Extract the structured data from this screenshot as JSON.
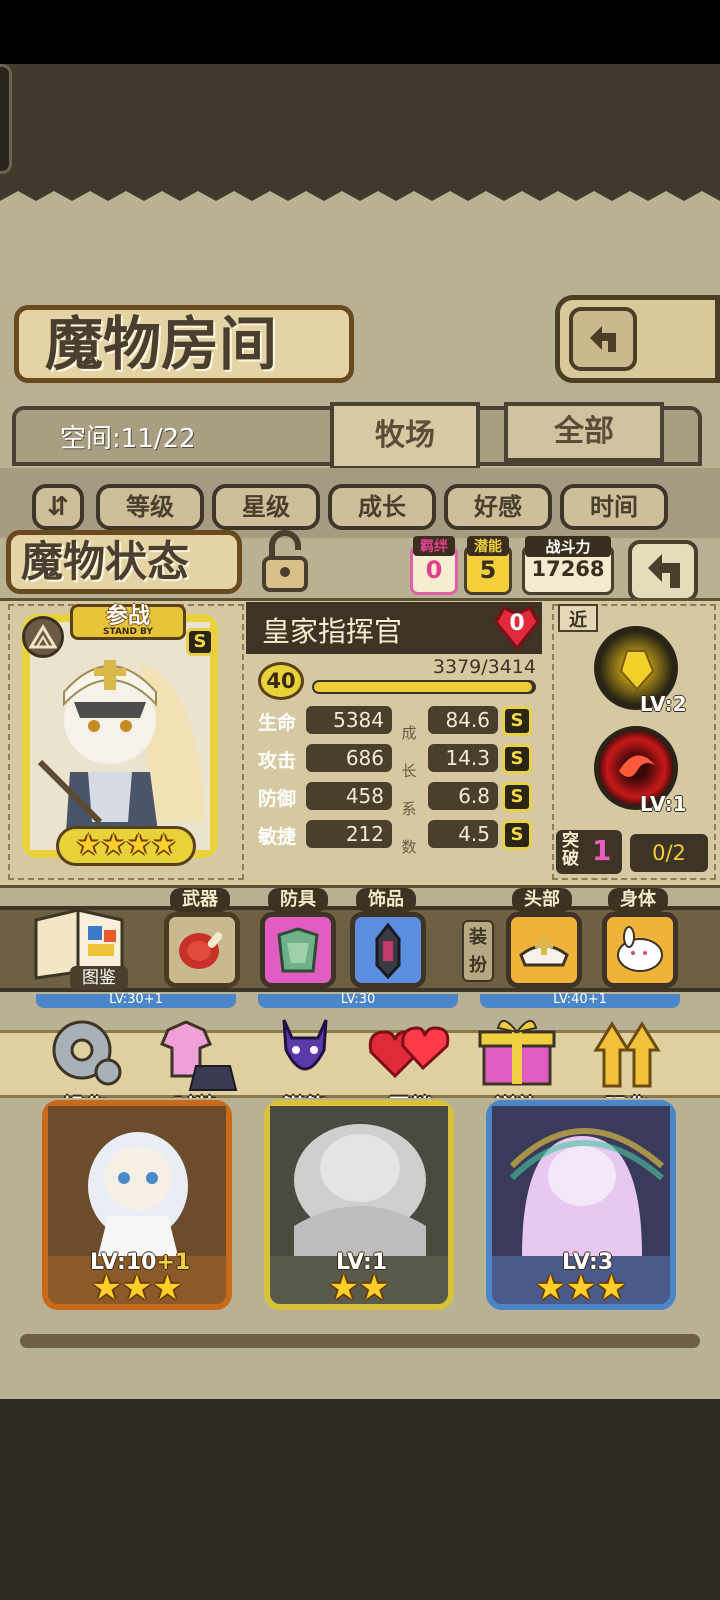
{
  "header": {
    "title": "魔物房间"
  },
  "tabs": {
    "space": "空间:11/22",
    "ranch": "牧场",
    "all": "全部"
  },
  "sort": [
    "等级",
    "星级",
    "成长",
    "好感",
    "时间"
  ],
  "status": {
    "title": "魔物状态",
    "bond_label": "羁绊",
    "bond_value": "0",
    "potential_label": "潜能",
    "potential_value": "5",
    "power_label": "战斗力",
    "power_value": "17268"
  },
  "monster": {
    "standby_label": "参战",
    "standby_sub": "STAND BY",
    "rank": "S",
    "name": "皇家指挥官",
    "heart_value": "0",
    "level": "40",
    "exp": "3379/3414",
    "exp_fraction": 0.99,
    "stars": 4
  },
  "stats": [
    {
      "label": "生命",
      "value": "5384",
      "growth": "84.6",
      "grade": "S"
    },
    {
      "label": "攻击",
      "value": "686",
      "growth": "14.3",
      "grade": "S"
    },
    {
      "label": "防御",
      "value": "458",
      "growth": "6.8",
      "grade": "S"
    },
    {
      "label": "敏捷",
      "value": "212",
      "growth": "4.5",
      "grade": "S"
    }
  ],
  "growth_caption": [
    "成",
    "长",
    "系",
    "数"
  ],
  "skills": {
    "range": "近",
    "skill1_lv": "LV:2",
    "skill2_lv": "LV:1",
    "breakthrough_label": "突破",
    "breakthrough_value": "1",
    "breakthrough_progress": "0/2"
  },
  "equipment": {
    "codex": "图鉴",
    "weapon": "武器",
    "armor": "防具",
    "accessory": "饰品",
    "dress_up": "装扮",
    "head": "头部",
    "body": "身体"
  },
  "actions": [
    "操作",
    "时装",
    "潜能",
    "羁绊",
    "送礼",
    "强化"
  ],
  "cards": [
    {
      "level": "LV:10",
      "bonus": "+1",
      "stars": 3
    },
    {
      "level": "LV:1",
      "bonus": "",
      "stars": 2
    },
    {
      "level": "LV:3",
      "bonus": "",
      "stars": 3
    }
  ],
  "partial_levels": [
    "LV:30+1",
    "LV:30",
    "LV:40+1"
  ]
}
